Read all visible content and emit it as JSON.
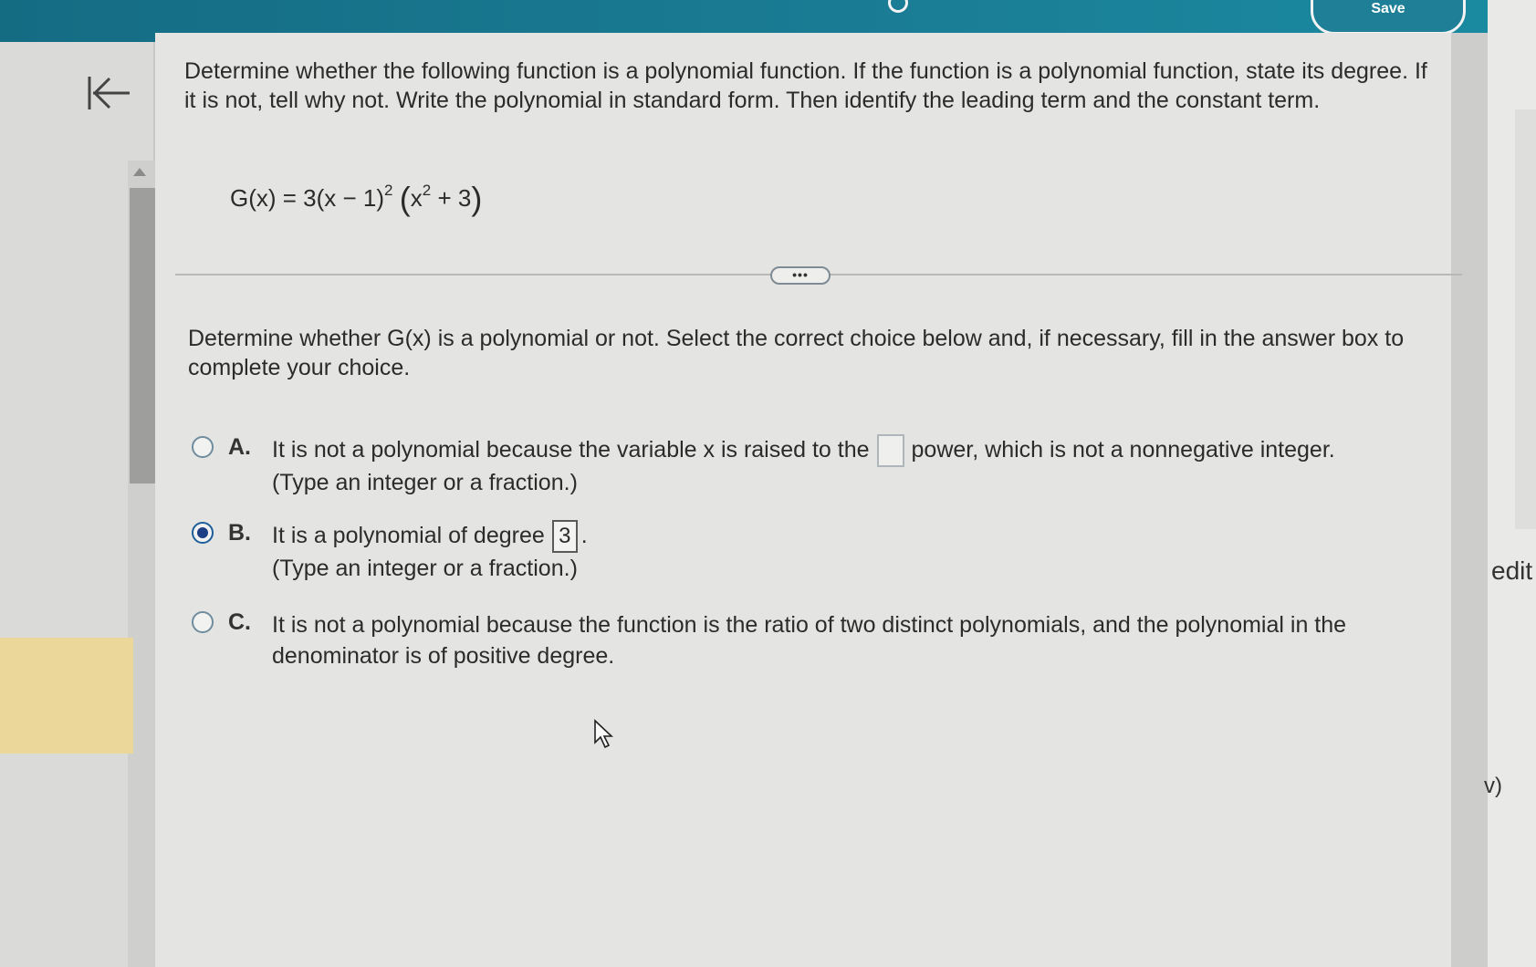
{
  "header": {
    "save_label": "Save"
  },
  "question": {
    "prompt": "Determine whether the following function is a polynomial function. If the function is a polynomial function, state its degree. If it is not, tell why not. Write the polynomial in standard form. Then identify the leading term and the constant term.",
    "equation": {
      "lhs": "G(x) = 3(x − 1)",
      "exp1": "2",
      "x": "x",
      "exp2": "2",
      "tail": " + 3"
    }
  },
  "expand_label": "•••",
  "instruction": "Determine whether G(x) is a polynomial or not. Select the correct choice below and, if necessary, fill in the answer box to complete your choice.",
  "choices": [
    {
      "letter": "A.",
      "text_before": "It is not a polynomial because the variable x is raised to the",
      "text_after": "power, which is not a nonnegative integer.",
      "hint": "(Type an integer or a fraction.)",
      "answer": "",
      "selected": false
    },
    {
      "letter": "B.",
      "text_before": "It is a polynomial of degree",
      "text_after": ".",
      "hint": "(Type an integer or a fraction.)",
      "answer": "3",
      "selected": true
    },
    {
      "letter": "C.",
      "text": "It is not a polynomial because the function is the ratio of two distinct polynomials, and the polynomial in the denominator is of positive degree.",
      "selected": false
    }
  ],
  "edge_text": {
    "edit": "edit",
    "v": "v)"
  },
  "icons": [
    "back-arrow-icon",
    "scroll-up-icon",
    "mouse-cursor-icon"
  ]
}
